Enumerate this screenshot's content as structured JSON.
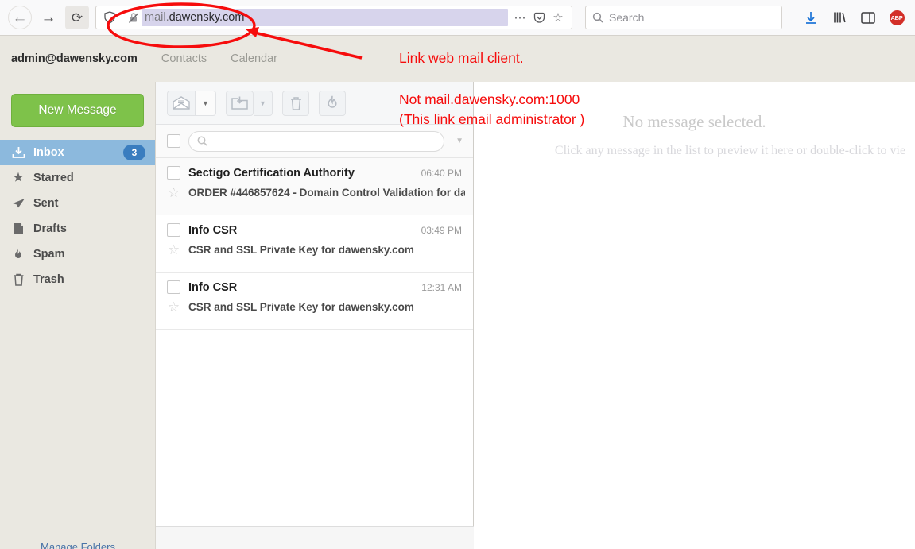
{
  "browser": {
    "back_icon": "back-arrow-icon",
    "forward_icon": "forward-arrow-icon",
    "reload_glyph": "⟳",
    "shield_glyph": "⛉",
    "url_prefix": "mail.",
    "url_domain": "dawensky.com",
    "url_full": "mail.dawensky.com",
    "page_actions_glyph": "⋯",
    "pocket_glyph": "⬠",
    "bookmark_glyph": "☆",
    "search_placeholder": "Search",
    "downloads_icon": "download-arrow-icon",
    "library_icon": "library-icon",
    "sidebar_icon": "sidebar-toggle-icon",
    "adblock_label": "ABP"
  },
  "webmail": {
    "account": "admin@dawensky.com",
    "nav": [
      {
        "label": "Contacts"
      },
      {
        "label": "Calendar"
      }
    ],
    "compose_label": "New Message",
    "folders": [
      {
        "label": "Inbox",
        "icon": "inbox-icon",
        "glyph": "⤓",
        "badge": "3",
        "active": true
      },
      {
        "label": "Starred",
        "icon": "star-icon",
        "glyph": "★",
        "badge": "",
        "active": false
      },
      {
        "label": "Sent",
        "icon": "sent-icon",
        "glyph": "➤",
        "badge": "",
        "active": false
      },
      {
        "label": "Drafts",
        "icon": "drafts-icon",
        "glyph": "■",
        "badge": "",
        "active": false
      },
      {
        "label": "Spam",
        "icon": "flame-icon",
        "glyph": "♨",
        "badge": "",
        "active": false
      },
      {
        "label": "Trash",
        "icon": "trash-icon",
        "glyph": "Ὕ1",
        "badge": "",
        "active": false
      }
    ],
    "sidebar_footer_link": "Manage Folders"
  },
  "toolbar": {
    "mark_read_icon": "open-envelope-icon",
    "mark_read_caret": "▼",
    "move_folder_icon": "move-to-folder-icon",
    "move_folder_caret": "▼",
    "delete_icon": "trash-icon",
    "spam_icon": "flame-icon"
  },
  "list": {
    "select_all": "select-all-checkbox",
    "search_placeholder": "",
    "search_icon": "search-icon",
    "options_caret": "▼",
    "messages": [
      {
        "from": "Sectigo Certification Authority",
        "time": "06:40 PM",
        "subject": "ORDER #446857624 - Domain Control Validation for da",
        "starred": false
      },
      {
        "from": "Info CSR",
        "time": "03:49 PM",
        "subject": "CSR and SSL Private Key for dawensky.com",
        "starred": false
      },
      {
        "from": "Info CSR",
        "time": "12:31 AM",
        "subject": "CSR and SSL Private Key for dawensky.com",
        "starred": false
      }
    ]
  },
  "preview": {
    "title": "No message selected.",
    "subtitle": "Click any message in the list to preview it here or double-click to vie"
  },
  "annotations": {
    "color": "#f60c0c",
    "note1": "Link web mail client.",
    "note2_line1": "Not mail.dawensky.com:1000",
    "note2_line2": "(This link email administrator )",
    "circle": "red-ellipse-around-url",
    "arrow": "red-arrow-pointing-to-url"
  }
}
